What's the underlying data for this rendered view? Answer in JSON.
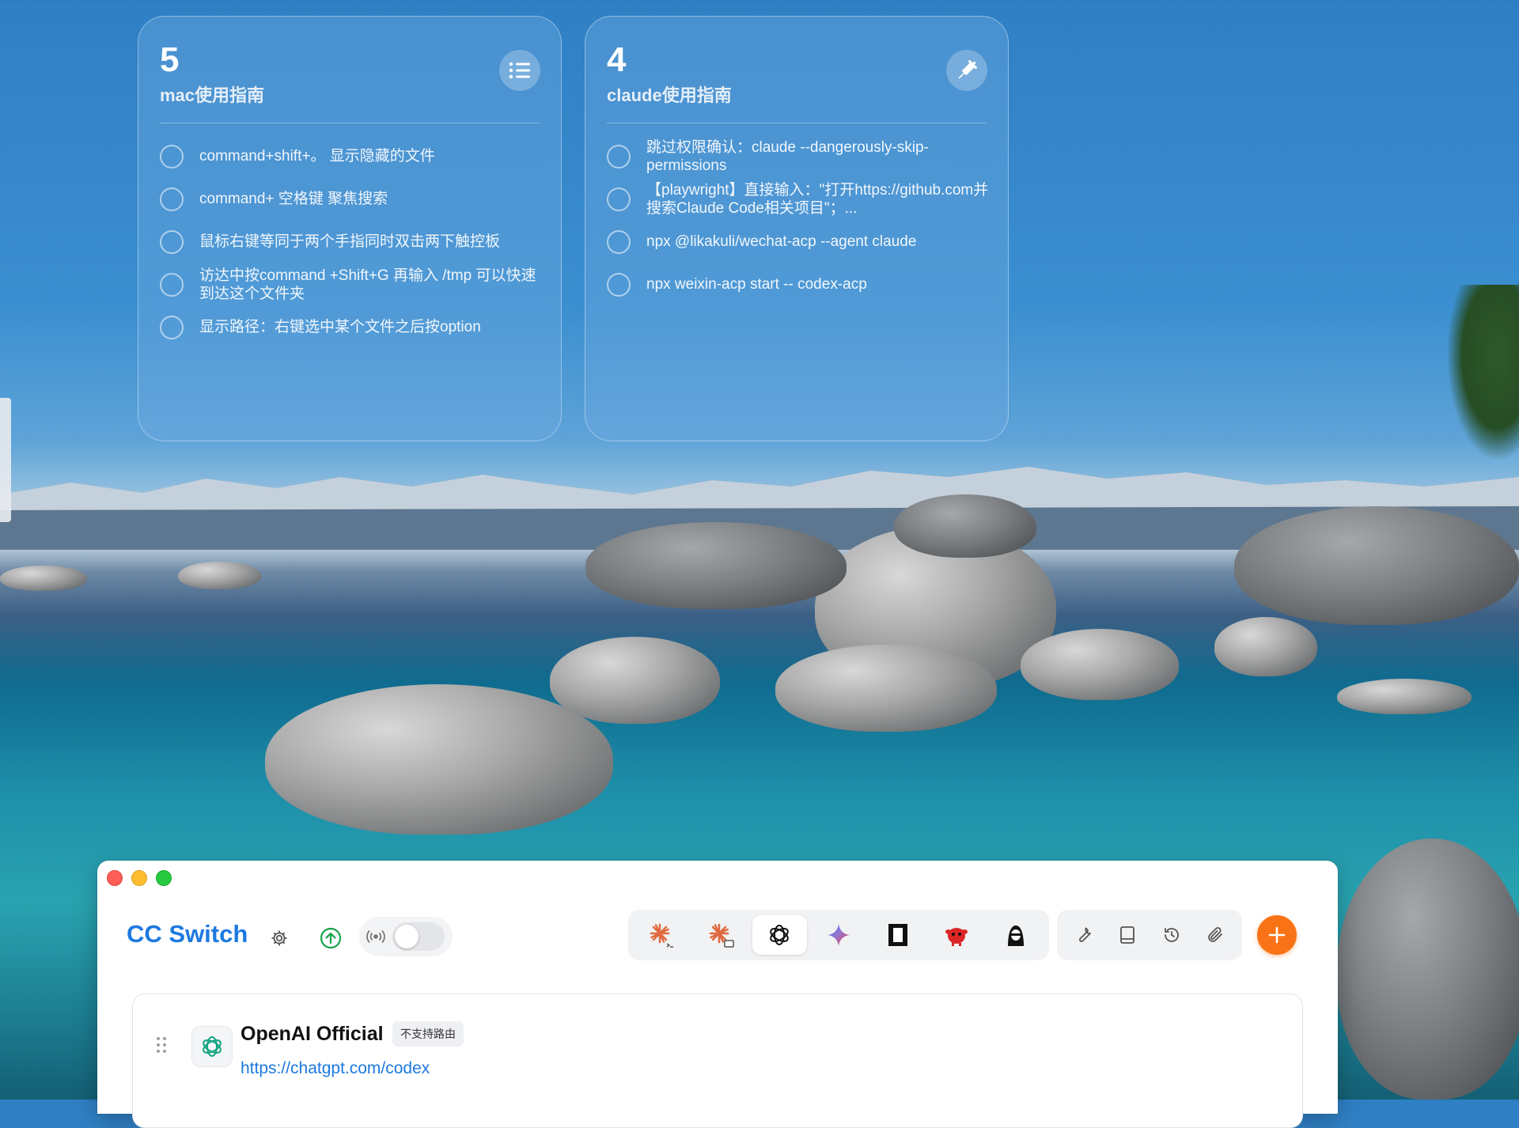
{
  "widgets": [
    {
      "count": "5",
      "title": "mac使用指南",
      "icon": "list-icon",
      "items": [
        "command+shift+。 显示隐藏的文件",
        "command+ 空格键  聚焦搜索",
        "鼠标右键等同于两个手指同时双击两下触控板",
        "访达中按command +Shift+G 再输入 /tmp 可以快速到达这个文件夹",
        "显示路径：右键选中某个文件之后按option"
      ]
    },
    {
      "count": "4",
      "title": "claude使用指南",
      "icon": "syringe-icon",
      "items": [
        "跳过权限确认：claude --dangerously-skip-permissions",
        "【playwright】直接输入：\"打开https://github.com并搜索Claude Code相关项目\"；...",
        "npx @likakuli/wechat-acp --agent claude",
        "npx weixin-acp start -- codex-acp"
      ]
    }
  ],
  "app": {
    "brand": "CC Switch",
    "toolbar_icons": [
      "claude-code-icon",
      "claude-desktop-icon",
      "openai-icon",
      "gemini-icon",
      "opencode-icon",
      "red-mascot-icon",
      "hacker-icon"
    ],
    "active_tool": "openai-icon",
    "util_icons": [
      "wrench-icon",
      "book-icon",
      "history-icon",
      "paperclip-icon"
    ],
    "proxy_enabled": false,
    "provider": {
      "name": "OpenAI Official",
      "tag": "不支持路由",
      "url": "https://chatgpt.com/codex"
    }
  },
  "colors": {
    "brand": "#1d79e0",
    "add": "#f97316"
  }
}
